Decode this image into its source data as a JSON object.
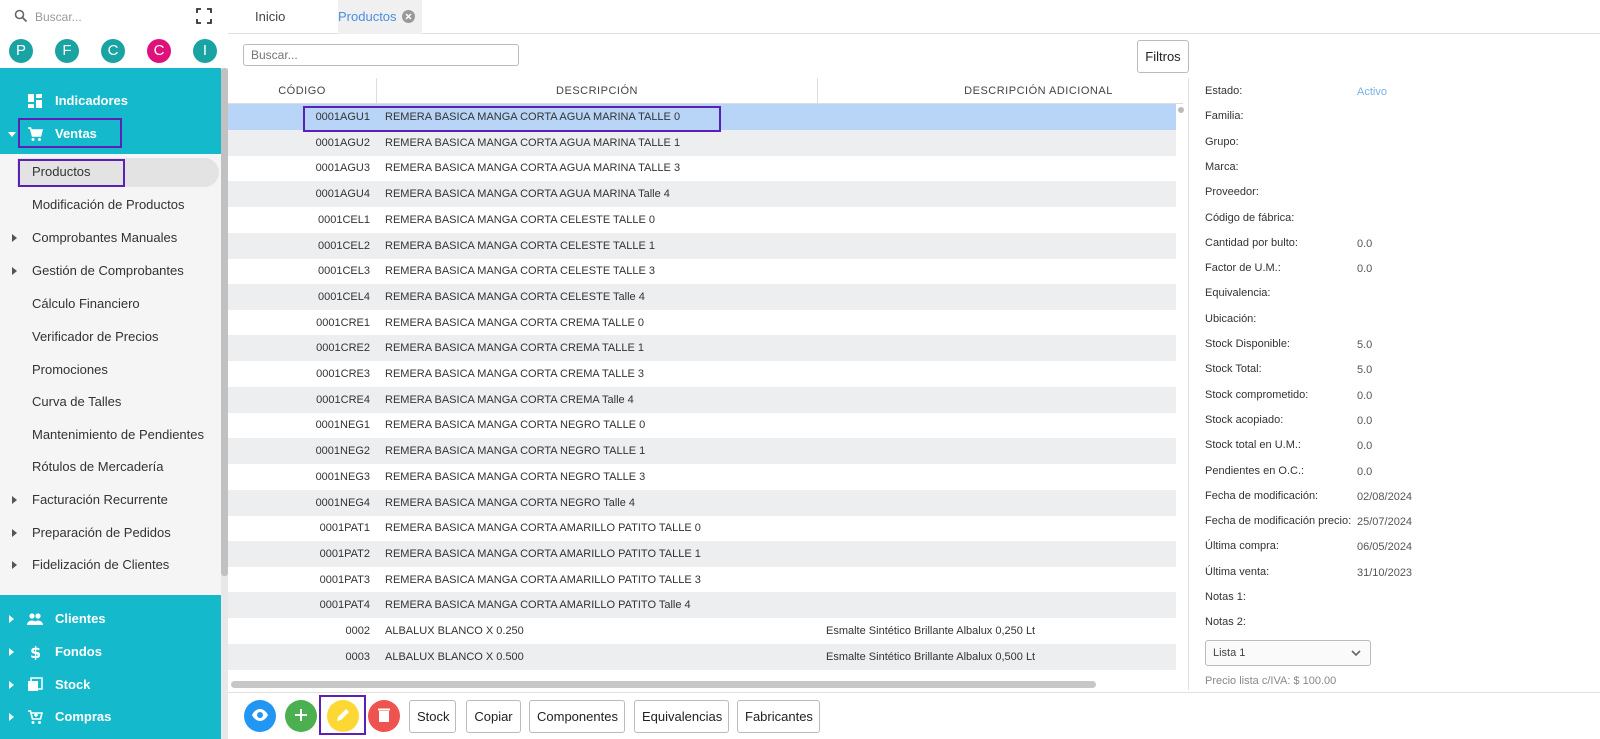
{
  "sidebar": {
    "search_placeholder": "Buscar...",
    "avatars": [
      "P",
      "F",
      "C",
      "C",
      "I"
    ],
    "avatar_colors": [
      "#1aa3a3",
      "#1aa3a3",
      "#1aa3a3",
      "#e0117a",
      "#1aa3a3"
    ],
    "top_items": {
      "indicadores": "Indicadores",
      "ventas": "Ventas",
      "clientes": "Clientes",
      "fondos": "Fondos",
      "stock": "Stock",
      "compras": "Compras"
    },
    "sub_items": [
      "Productos",
      "Modificación de Productos",
      "Comprobantes Manuales",
      "Gestión de Comprobantes",
      "Cálculo Financiero",
      "Verificador de Precios",
      "Promociones",
      "Curva de Talles",
      "Mantenimiento de Pendientes",
      "Rótulos de Mercadería",
      "Facturación Recurrente",
      "Preparación de Pedidos",
      "Fidelización de Clientes"
    ],
    "accent_color": "#14b9cb"
  },
  "tabs": {
    "inicio": "Inicio",
    "productos": "Productos"
  },
  "toolbar": {
    "search_placeholder": "Buscar...",
    "filtros": "Filtros"
  },
  "table": {
    "headers": [
      "CÓDIGO",
      "DESCRIPCIÓN",
      "DESCRIPCIÓN ADICIONAL"
    ],
    "rows": [
      {
        "code": "0001AGU1",
        "desc": "REMERA BASICA MANGA CORTA AGUA MARINA TALLE 0",
        "add": ""
      },
      {
        "code": "0001AGU2",
        "desc": "REMERA BASICA MANGA CORTA AGUA MARINA TALLE 1",
        "add": ""
      },
      {
        "code": "0001AGU3",
        "desc": "REMERA BASICA MANGA CORTA AGUA MARINA TALLE 3",
        "add": ""
      },
      {
        "code": "0001AGU4",
        "desc": "REMERA BASICA MANGA CORTA AGUA MARINA Talle 4",
        "add": ""
      },
      {
        "code": "0001CEL1",
        "desc": "REMERA BASICA MANGA CORTA CELESTE TALLE 0",
        "add": ""
      },
      {
        "code": "0001CEL2",
        "desc": "REMERA BASICA MANGA CORTA CELESTE TALLE 1",
        "add": ""
      },
      {
        "code": "0001CEL3",
        "desc": "REMERA BASICA MANGA CORTA CELESTE TALLE 3",
        "add": ""
      },
      {
        "code": "0001CEL4",
        "desc": "REMERA BASICA MANGA CORTA CELESTE Talle 4",
        "add": ""
      },
      {
        "code": "0001CRE1",
        "desc": "REMERA BASICA MANGA CORTA CREMA TALLE 0",
        "add": ""
      },
      {
        "code": "0001CRE2",
        "desc": "REMERA BASICA MANGA CORTA CREMA TALLE 1",
        "add": ""
      },
      {
        "code": "0001CRE3",
        "desc": "REMERA BASICA MANGA CORTA CREMA TALLE 3",
        "add": ""
      },
      {
        "code": "0001CRE4",
        "desc": "REMERA BASICA MANGA CORTA CREMA Talle 4",
        "add": ""
      },
      {
        "code": "0001NEG1",
        "desc": "REMERA BASICA MANGA CORTA NEGRO TALLE 0",
        "add": ""
      },
      {
        "code": "0001NEG2",
        "desc": "REMERA BASICA MANGA CORTA NEGRO TALLE 1",
        "add": ""
      },
      {
        "code": "0001NEG3",
        "desc": "REMERA BASICA MANGA CORTA NEGRO TALLE 3",
        "add": ""
      },
      {
        "code": "0001NEG4",
        "desc": "REMERA BASICA MANGA CORTA NEGRO Talle 4",
        "add": ""
      },
      {
        "code": "0001PAT1",
        "desc": "REMERA BASICA MANGA CORTA AMARILLO PATITO TALLE 0",
        "add": ""
      },
      {
        "code": "0001PAT2",
        "desc": "REMERA BASICA MANGA CORTA AMARILLO PATITO TALLE 1",
        "add": ""
      },
      {
        "code": "0001PAT3",
        "desc": "REMERA BASICA MANGA CORTA AMARILLO PATITO TALLE 3",
        "add": ""
      },
      {
        "code": "0001PAT4",
        "desc": "REMERA BASICA MANGA CORTA AMARILLO PATITO Talle 4",
        "add": ""
      },
      {
        "code": "0002",
        "desc": "ALBALUX BLANCO X 0.250",
        "add": "Esmalte Sintético Brillante Albalux 0,250 Lt"
      },
      {
        "code": "0003",
        "desc": "ALBALUX BLANCO X 0.500",
        "add": "Esmalte Sintético Brillante Albalux 0,500 Lt"
      }
    ]
  },
  "detail": {
    "fields": [
      {
        "label": "Estado:",
        "value": "Activo"
      },
      {
        "label": "Familia:",
        "value": ""
      },
      {
        "label": "Grupo:",
        "value": ""
      },
      {
        "label": "Marca:",
        "value": ""
      },
      {
        "label": "Proveedor:",
        "value": ""
      },
      {
        "label": "Código de fábrica:",
        "value": ""
      },
      {
        "label": "Cantidad por bulto:",
        "value": "0.0"
      },
      {
        "label": "Factor de U.M.:",
        "value": "0.0"
      },
      {
        "label": "Equivalencia:",
        "value": ""
      },
      {
        "label": "Ubicación:",
        "value": ""
      },
      {
        "label": "Stock Disponible:",
        "value": "5.0"
      },
      {
        "label": "Stock Total:",
        "value": "5.0"
      },
      {
        "label": "Stock comprometido:",
        "value": "0.0"
      },
      {
        "label": "Stock acopiado:",
        "value": "0.0"
      },
      {
        "label": "Stock total en U.M.:",
        "value": "0.0"
      },
      {
        "label": "Pendientes en O.C.:",
        "value": "0.0"
      },
      {
        "label": "Fecha de modificación:",
        "value": "02/08/2024"
      },
      {
        "label": "Fecha de modificación precio:",
        "value": "25/07/2024"
      },
      {
        "label": "Última compra:",
        "value": "06/05/2024"
      },
      {
        "label": "Última venta:",
        "value": "31/10/2023"
      },
      {
        "label": "Notas 1:",
        "value": ""
      },
      {
        "label": "Notas 2:",
        "value": ""
      }
    ],
    "lista_selected": "Lista 1",
    "precio": "Precio lista c/IVA: $ 100.00"
  },
  "bottom": {
    "stock": "Stock",
    "copiar": "Copiar",
    "componentes": "Componentes",
    "equivalencias": "Equivalencias",
    "fabricantes": "Fabricantes",
    "colors": {
      "view": "#2196f3",
      "add": "#4caf50",
      "edit": "#fdd835",
      "delete": "#ef5350"
    }
  }
}
